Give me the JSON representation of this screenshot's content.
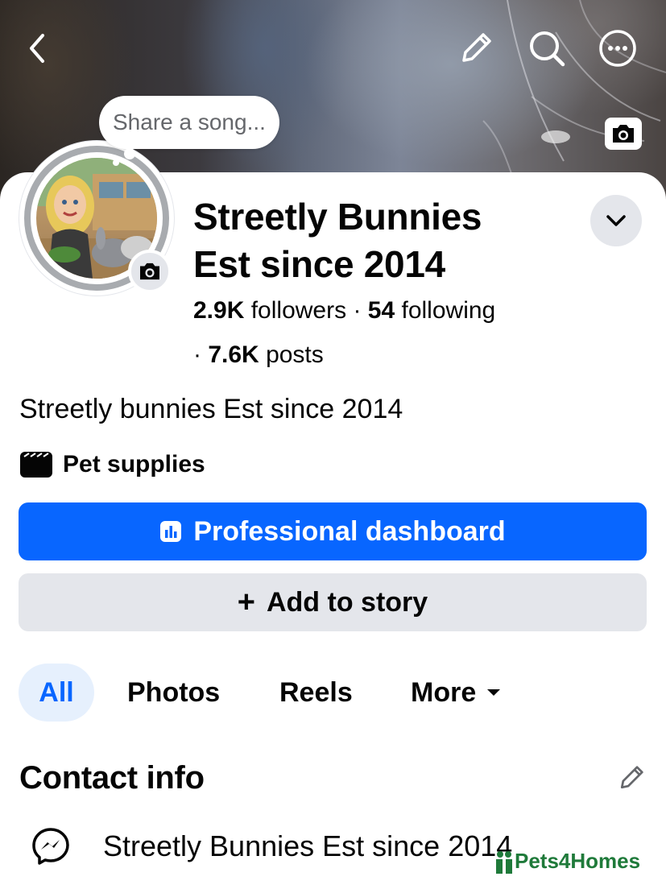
{
  "top_bar": {
    "back_icon": "chevron-left-icon",
    "edit_icon": "pencil-icon",
    "search_icon": "search-icon",
    "more_icon": "more-horizontal-icon"
  },
  "share_song": {
    "placeholder": "Share a song..."
  },
  "profile": {
    "name_line1": "Streetly Bunnies",
    "name_line2": "Est since 2014",
    "followers_count": "2.9K",
    "followers_label": "followers",
    "separator": "·",
    "following_count": "54",
    "following_label": "following",
    "posts_prefix": "·",
    "posts_count": "7.6K",
    "posts_label": "posts",
    "bio": "Streetly bunnies Est since 2014",
    "category": "Pet supplies"
  },
  "actions": {
    "primary": "Professional dashboard",
    "secondary": "Add to story",
    "secondary_prefix": "+"
  },
  "tabs": [
    {
      "label": "All",
      "active": true
    },
    {
      "label": "Photos",
      "active": false
    },
    {
      "label": "Reels",
      "active": false
    },
    {
      "label": "More",
      "active": false
    }
  ],
  "contact": {
    "title": "Contact info",
    "messenger_text": "Streetly Bunnies Est since 2014"
  },
  "watermark": {
    "text": "Pets4Homes"
  },
  "colors": {
    "accent": "#0866ff",
    "secondary_button": "#e4e6eb",
    "active_tab_bg": "#e6f0fd",
    "muted_text": "#65676b"
  }
}
